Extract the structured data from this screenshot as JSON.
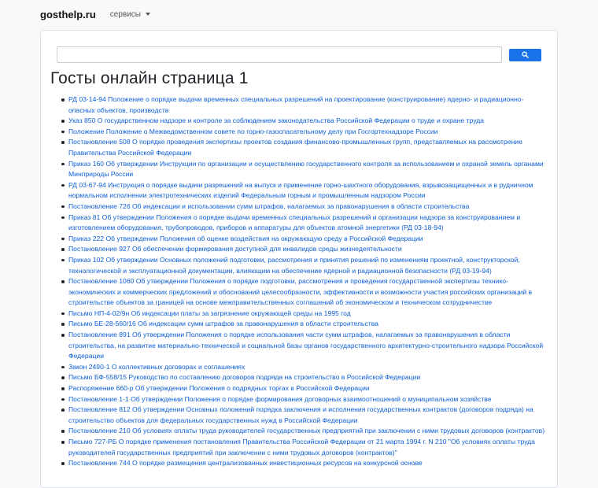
{
  "header": {
    "brand": "gosthelp.ru",
    "services_label": "сервисы"
  },
  "search": {
    "value": ""
  },
  "page_title": "Госты онлайн страница 1",
  "documents": [
    "РД 03-14-94 Положение о порядке выдачи временных специальных разрешений на проектирование (конструирование) ядерно- и радиационно-опасных объектов, производств",
    "Указ 850 О государственном надзоре и контроле за соблюдением законодательства Российской Федерации о труде и охране труда",
    "Положение Положение о Межведомственном совете по горно-газоспасательному делу при Госгортехнадзоре России",
    "Постановление 508 О порядке проведения экспертизы проектов создания финансово-промышленных групп, представляемых на рассмотрение Правительства Российской Федерации",
    "Приказ 160 Об утверждении Инструкции по организации и осуществлению государственного контроля за использованием и охраной земель органами Минприроды России",
    "РД 03-67-94 Инструкция о порядке выдачи разрешений на выпуск и применение горно-шахтного оборудования, взрывозащищенных и в рудничном нормальном исполнении электротехнических изделий Федеральным горным и промышленным надзором России",
    "Постановление 726 Об индексации и использовании сумм штрафов, налагаемых за правонарушения в области строительства",
    "Приказ 81 Об утверждении Положения о порядке выдачи временных специальных разрешений и организации надзора за конструированием и изготовлением оборудования, трубопроводов, приборов и аппаратуры для объектов атомной энергетики (РД 03-18-94)",
    "Приказ 222 Об утверждении Положения об оценке воздействия на окружающую среду в Российской Федерации",
    "Постановление 927 Об обеспечении формирования доступной для инвалидов среды жизнедеятельности",
    "Приказ 102 Об утверждении Основных положений подготовки, рассмотрения и принятия решений по изменениям проектной, конструкторской, технологической и эксплуатационной документации, влияющим на обеспечение ядерной и радиационной безопасности (РД 03-19-94)",
    "Постановление 1060 Об утверждении Положения о порядке подготовки, рассмотрения и проведения государственной экспертизы технико-экономических и коммерческих предложений и обоснований целесообразности, эффективности и возможности участия российских организаций в строительстве объектов за границей на основе межправительственных соглашений об экономическом и техническом сотрудничестве",
    "Письмо НП-4-02/9н Об индексации платы за загрязнение окружающей среды на 1995 год",
    "Письмо БЕ-28-560/16 Об индексации сумм штрафов за правонарушения в области строительства",
    "Постановление 891 Об утверждении Положения о порядке использования части сумм штрафов, налагаемых за правонарушения в области строительства, на развитие материально-технической и социальной базы органов государственного архитектурно-строительного надзора Российской Федерации",
    "Закон 2490-1 О коллективных договорах и соглашениях",
    "Письмо БФ-558/15 Руководство по составлению договоров подряда на строительство в Российской Федерации",
    "Распоряжение 660-р Об утверждении Положения о подрядных торгах в Российской Федерации",
    "Постановление 1-1 Об утверждении Положения о порядке формирования договорных взаимоотношений о муниципальном хозяйстве",
    "Постановление 812 Об утверждении Основных положений порядка заключения и исполнения государственных контрактов (договоров подряда) на строительство объектов для федеральных государственных нужд в Российской Федерации",
    "Постановление 210 Об условиях оплаты труда руководителей государственных предприятий при заключении с ними трудовых договоров (контрактов)",
    "Письмо 727-РБ О порядке применения постановления Правительства Российской Федерации от 21 марта 1994 г. N 210 \"Об условиях оплаты труда руководителей государственных предприятий при заключении с ними трудовых договоров (контрактов)\"",
    "Постановление 744 О порядке размещения централизованных инвестиционных ресурсов на конкурсной основе"
  ]
}
